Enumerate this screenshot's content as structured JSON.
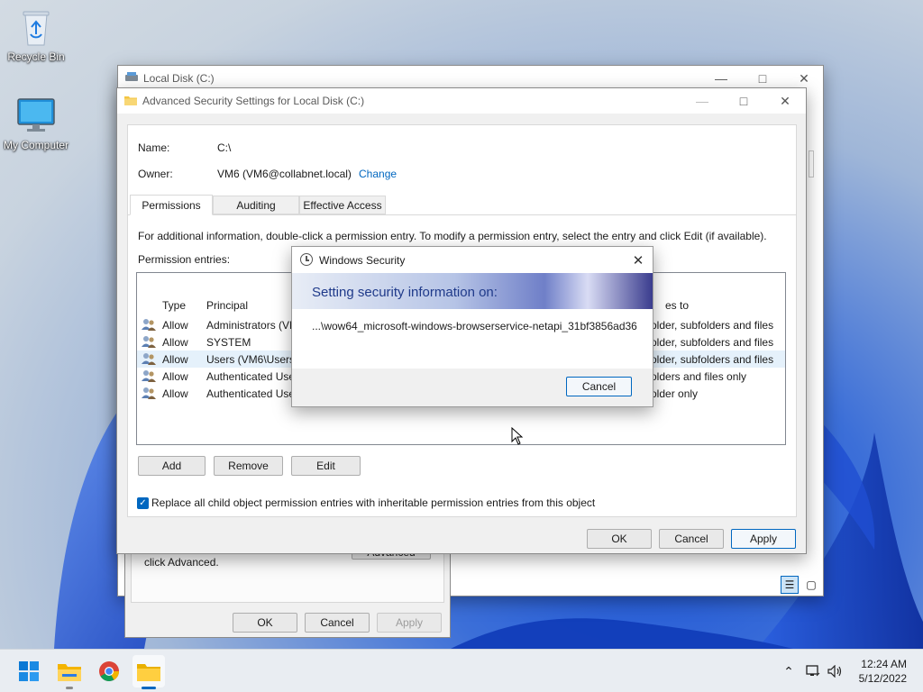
{
  "desktop": {
    "icons": [
      {
        "label": "Recycle Bin",
        "icon": "recycle-bin-icon"
      },
      {
        "label": "My Computer",
        "icon": "computer-icon"
      }
    ]
  },
  "props_window": {
    "title": "Local Disk (C:)",
    "bottom_text": "click Advanced.",
    "advanced_label": "Advanced",
    "ok_label": "OK",
    "cancel_label": "Cancel",
    "apply_label": "Apply"
  },
  "adv_window": {
    "title": "Advanced Security Settings for Local Disk (C:)",
    "name_label": "Name:",
    "name_value": "C:\\",
    "owner_label": "Owner:",
    "owner_value": "VM6 (VM6@collabnet.local)",
    "change_label": "Change",
    "tabs": [
      {
        "label": "Permissions",
        "selected": true
      },
      {
        "label": "Auditing",
        "selected": false
      },
      {
        "label": "Effective Access",
        "selected": false
      }
    ],
    "info_text": "For additional information, double-click a permission entry. To modify a permission entry, select the entry and click Edit (if available).",
    "entries_label": "Permission entries:",
    "columns": {
      "type": "Type",
      "principal": "Principal",
      "applies": "es to"
    },
    "rows": [
      {
        "type": "Allow",
        "principal": "Administrators (VM",
        "applies": "older, subfolders and files",
        "selected": false
      },
      {
        "type": "Allow",
        "principal": "SYSTEM",
        "applies": "older, subfolders and files",
        "selected": false
      },
      {
        "type": "Allow",
        "principal": "Users (VM6\\Users)",
        "applies": "older, subfolders and files",
        "selected": true
      },
      {
        "type": "Allow",
        "principal": "Authenticated Use",
        "applies": "olders and files only",
        "selected": false
      },
      {
        "type": "Allow",
        "principal": "Authenticated Use",
        "applies": "older only",
        "selected": false
      }
    ],
    "add_label": "Add",
    "remove_label": "Remove",
    "edit_label": "Edit",
    "replace_checkbox_label": "Replace all child object permission entries with inheritable permission entries from this object",
    "replace_checked": true,
    "ok_label": "OK",
    "cancel_label": "Cancel",
    "apply_label": "Apply"
  },
  "security_dialog": {
    "title": "Windows Security",
    "heading": "Setting security information on:",
    "path": "...\\wow64_microsoft-windows-browserservice-netapi_31bf3856ad36",
    "cancel_label": "Cancel"
  },
  "taskbar": {
    "apps": [
      "start-icon",
      "file-explorer-icon",
      "chrome-icon",
      "folder-icon"
    ],
    "time": "12:24 AM",
    "date": "5/12/2022"
  },
  "colors": {
    "accent": "#0067c0",
    "link": "#0067c0",
    "banner_start": "#dfe6f3",
    "banner_end": "#3a3c8e"
  }
}
